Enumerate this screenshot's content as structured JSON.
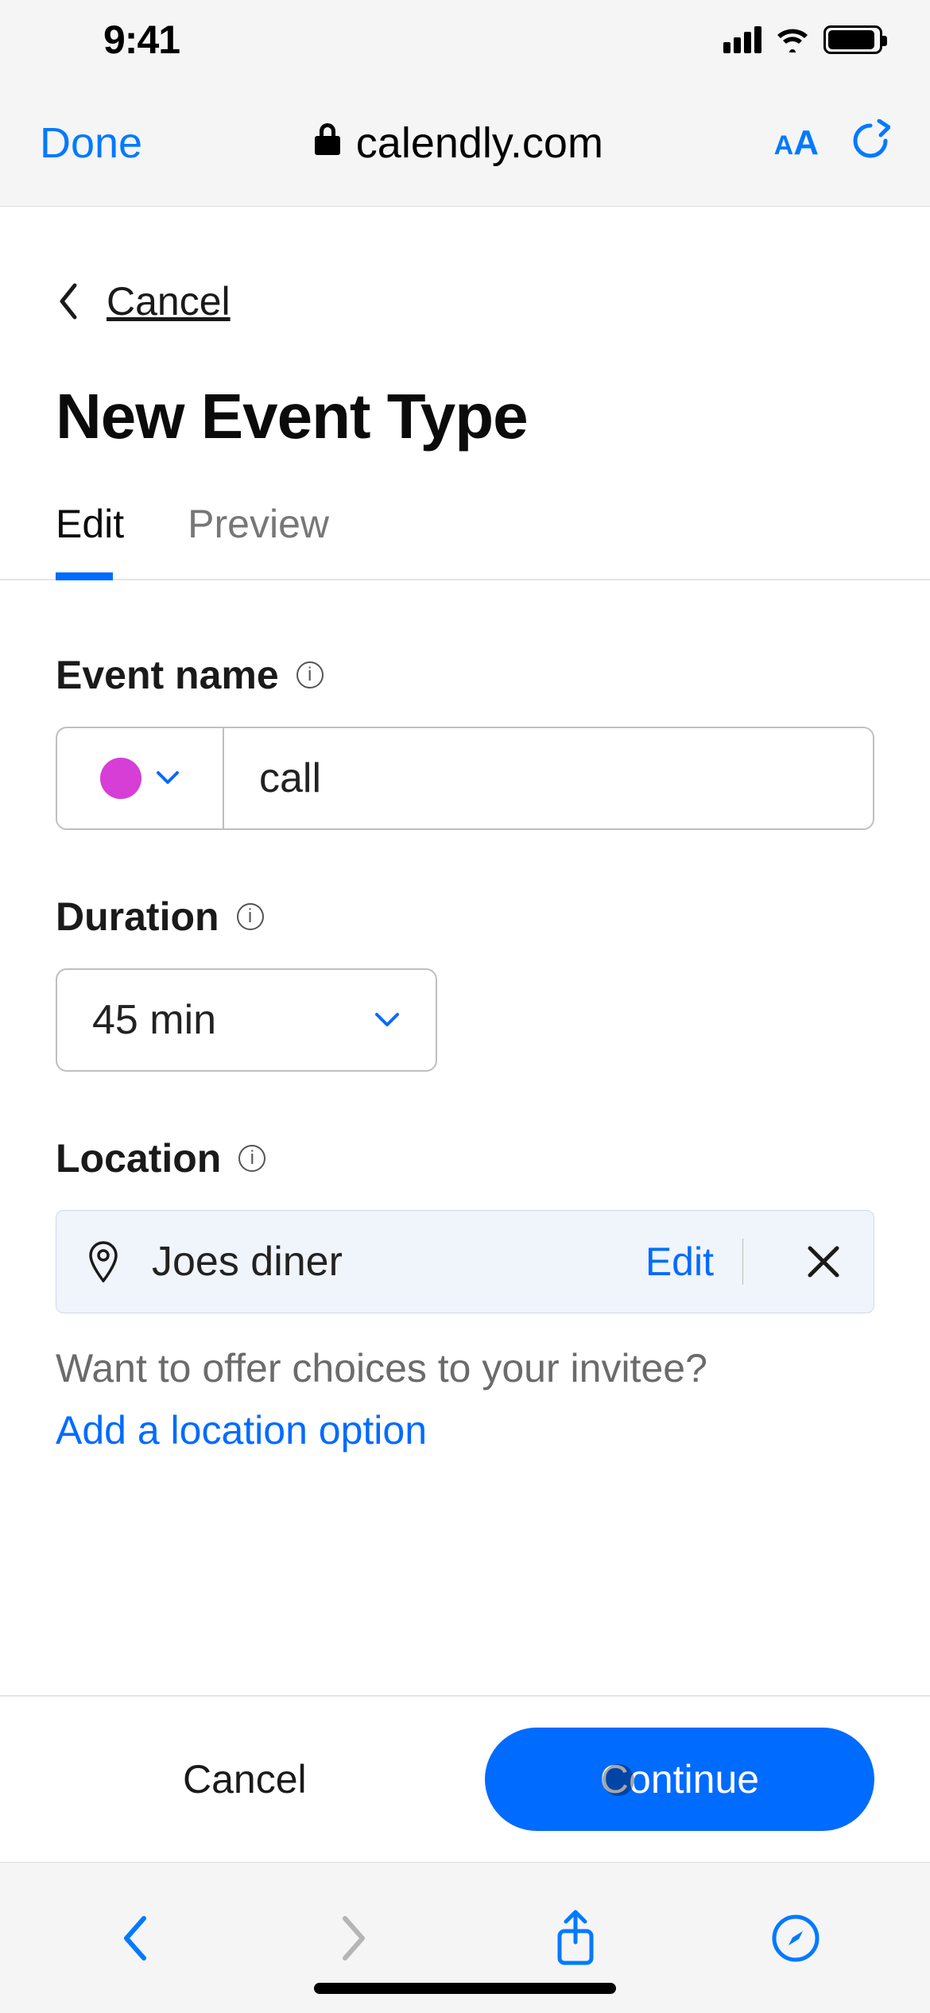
{
  "status": {
    "time": "9:41"
  },
  "browser": {
    "done_label": "Done",
    "url": "calendly.com"
  },
  "header": {
    "cancel_label": "Cancel",
    "title": "New Event Type"
  },
  "tabs": {
    "edit": "Edit",
    "preview": "Preview"
  },
  "form": {
    "event_name": {
      "label": "Event name",
      "color": "#d63ed6",
      "value": "call"
    },
    "duration": {
      "label": "Duration",
      "value": "45 min"
    },
    "location": {
      "label": "Location",
      "value": "Joes diner",
      "edit_label": "Edit",
      "hint": "Want to offer choices to your invitee?",
      "add_label": "Add a location option"
    }
  },
  "footer": {
    "cancel_label": "Cancel",
    "continue_label": "Continue"
  }
}
